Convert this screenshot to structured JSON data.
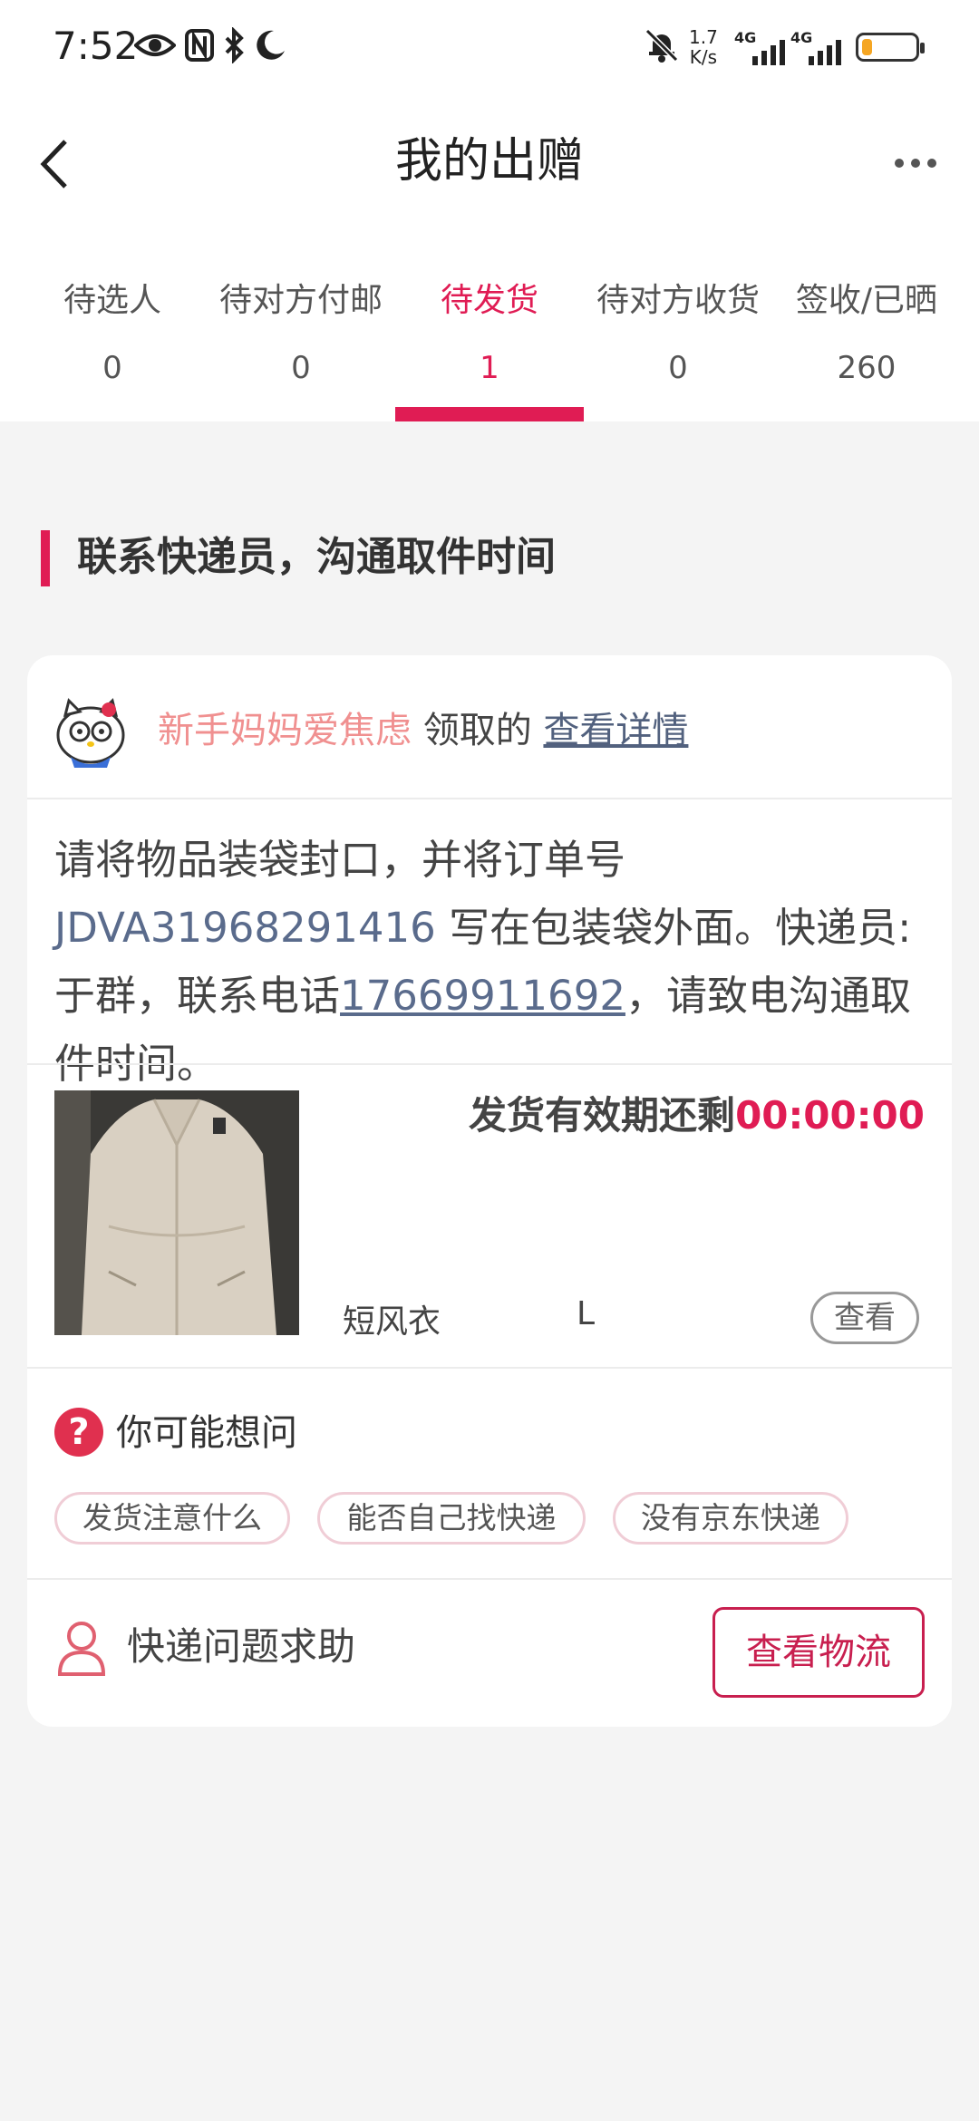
{
  "status_bar": {
    "time": "7:52",
    "speed_value": "1.7",
    "speed_unit": "K/s",
    "network_1": "4G",
    "network_2": "4G",
    "icons": [
      "eye-icon",
      "nfc-icon",
      "bluetooth-icon",
      "moon-icon",
      "bell-muted-icon",
      "signal-icon",
      "battery-icon"
    ],
    "battery_level": 0.2,
    "battery_color": "#f5a623"
  },
  "header": {
    "title": "我的出赠"
  },
  "tabs": [
    {
      "label": "待选人",
      "count": "0"
    },
    {
      "label": "待对方付邮",
      "count": "0"
    },
    {
      "label": "待发货",
      "count": "1"
    },
    {
      "label": "待对方收货",
      "count": "0"
    },
    {
      "label": "签收/已晒",
      "count": "260"
    }
  ],
  "active_tab": "待发货",
  "accent_color": "#e01c54",
  "section": {
    "title": "联系快递员，沟通取件时间"
  },
  "card": {
    "recipient_name": "新手妈妈爱焦虑",
    "recipient_suffix": "领取的",
    "detail_link": "查看详情",
    "instruction_part1": "请将物品装袋封口，并将订单号 ",
    "order_number": "JDVA31968291416",
    "instruction_part2": " 写在包装袋外面。快递员:于群，联系电话",
    "courier_phone": "17669911692",
    "instruction_part3": "，请致电沟通取件时间。",
    "validity_label": "发货有效期还剩",
    "countdown": "00:00:00",
    "item_name": "短风衣",
    "item_size": "L",
    "view_button": "查看",
    "faq_title": "你可能想问",
    "faq_chips": [
      "发货注意什么",
      "能否自己找快递",
      "没有京东快递"
    ],
    "help_label": "快递问题求助",
    "logistics_button": "查看物流"
  }
}
